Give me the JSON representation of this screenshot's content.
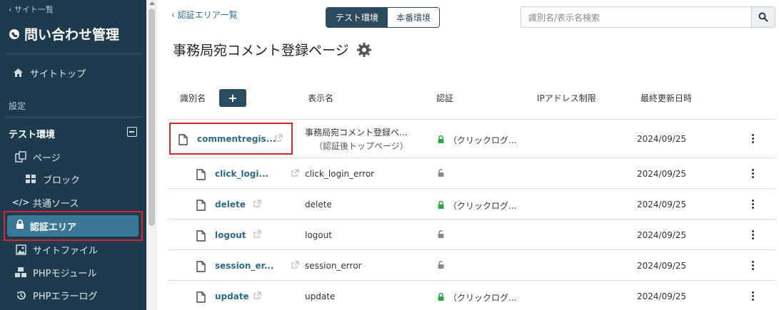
{
  "sidebar": {
    "back_label": "‹ サイト一覧",
    "site_title": "問い合わせ管理",
    "site_top": "サイトトップ",
    "settings_label": "設定",
    "env_label": "テスト環境",
    "items": [
      {
        "label": "ページ",
        "icon": "pages-icon"
      },
      {
        "label": "ブロック",
        "icon": "block-icon"
      },
      {
        "label": "共通ソース",
        "icon": "code-icon"
      },
      {
        "label": "認証エリア",
        "icon": "lock-icon",
        "active": true
      },
      {
        "label": "サイトファイル",
        "icon": "image-icon"
      },
      {
        "label": "PHPモジュール",
        "icon": "cubes-icon"
      },
      {
        "label": "PHPエラーログ",
        "icon": "history-icon"
      }
    ]
  },
  "breadcrumb": "‹ 認証エリア一覧",
  "env_toggle": {
    "test": "テスト環境",
    "prod": "本番環境",
    "selected": "test"
  },
  "search": {
    "placeholder": "識別名/表示名検索"
  },
  "page_title": "事務局宛コメント登録ページ",
  "columns": {
    "ident": "識別名",
    "display": "表示名",
    "auth": "認証",
    "ip": "IPアドレス制限",
    "updated": "最終更新日時"
  },
  "add_button": "+",
  "rows": [
    {
      "ident": "commentregis...",
      "display": "事務局宛コメント登録ペ...",
      "display_sub": "（認証後トップページ）",
      "auth": "（クリックログ...",
      "auth_locked": true,
      "updated": "2024/09/25"
    },
    {
      "ident": "click_logi...",
      "display": "click_login_error",
      "display_sub": "",
      "auth": "",
      "auth_locked": false,
      "updated": "2024/09/25"
    },
    {
      "ident": "delete",
      "display": "delete",
      "display_sub": "",
      "auth": "（クリックログ...",
      "auth_locked": true,
      "updated": "2024/09/25"
    },
    {
      "ident": "logout",
      "display": "logout",
      "display_sub": "",
      "auth": "",
      "auth_locked": false,
      "updated": "2024/09/25"
    },
    {
      "ident": "session_er...",
      "display": "session_error",
      "display_sub": "",
      "auth": "",
      "auth_locked": false,
      "updated": "2024/09/25"
    },
    {
      "ident": "update",
      "display": "update",
      "display_sub": "",
      "auth": "（クリックログ...",
      "auth_locked": true,
      "updated": "2024/09/25"
    }
  ],
  "colors": {
    "sidebar_bg": "#1e3b4e",
    "active_bg": "#3b7797",
    "accent": "#2b4b5e",
    "highlight": "#d9262c",
    "lock_green": "#28a745"
  }
}
